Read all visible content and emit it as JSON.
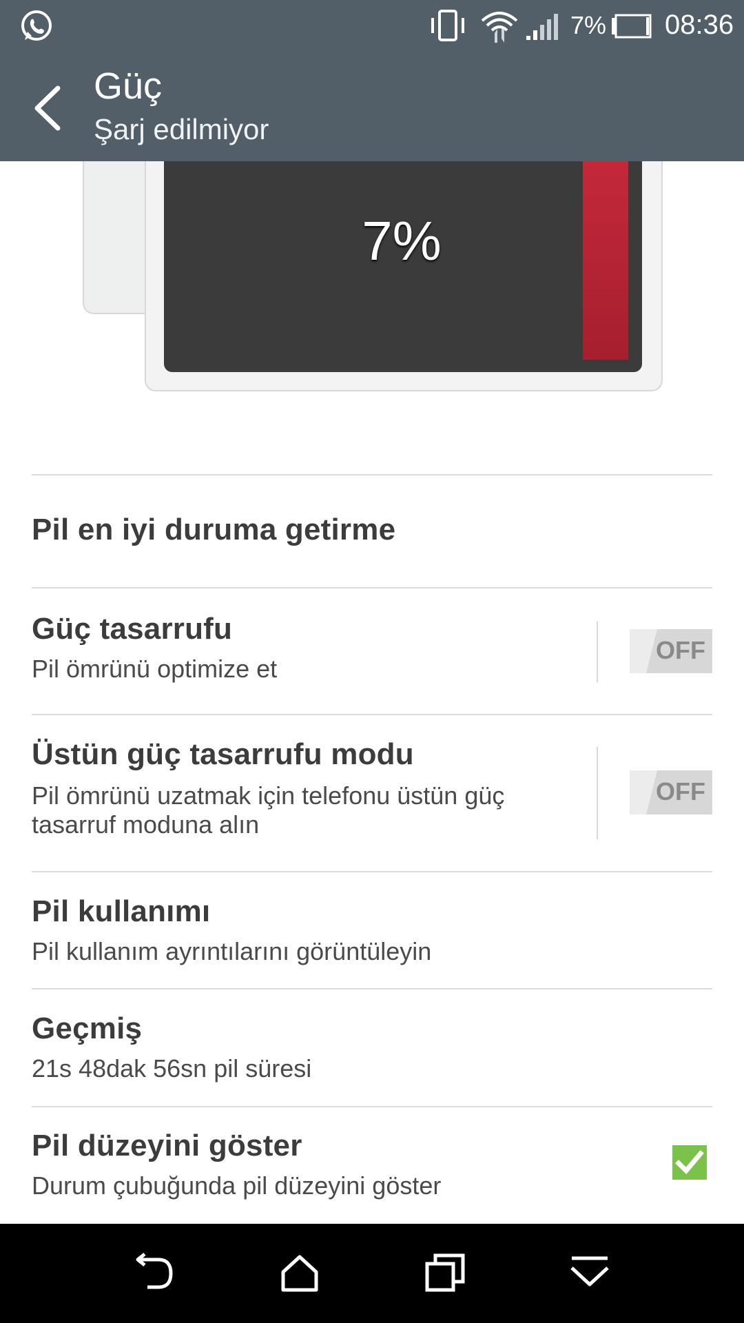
{
  "status_bar": {
    "battery_percent": "7%",
    "time": "08:36",
    "icons": [
      "whatsapp-icon",
      "vibrate-icon",
      "wifi-icon",
      "signal-icon",
      "battery-icon"
    ]
  },
  "action_bar": {
    "title": "Güç",
    "subtitle": "Şarj edilmiyor"
  },
  "battery_graphic": {
    "level_text": "7%",
    "level": 0.07,
    "level_color": "#b3232f"
  },
  "settings": {
    "optimize": {
      "title": "Pil en iyi duruma getirme"
    },
    "power_saver": {
      "title": "Güç tasarrufu",
      "subtitle": "Pil ömrünü optimize et",
      "toggle": "OFF"
    },
    "extreme_saver": {
      "title": "Üstün güç tasarrufu modu",
      "subtitle_line1": "Pil ömrünü uzatmak için telefonu üstün güç",
      "subtitle_line2": "tasarruf moduna alın",
      "toggle": "OFF"
    },
    "battery_usage": {
      "title": "Pil kullanımı",
      "subtitle": "Pil kullanım ayrıntılarını görüntüleyin"
    },
    "history": {
      "title": "Geçmiş",
      "subtitle": "21s 48dak 56sn pil süresi"
    },
    "show_level": {
      "title": "Pil düzeyini göster",
      "subtitle": "Durum çubuğunda pil düzeyini göster",
      "checked": true
    }
  },
  "colors": {
    "bar": "#525f68",
    "accent_check": "#7ac24a"
  }
}
